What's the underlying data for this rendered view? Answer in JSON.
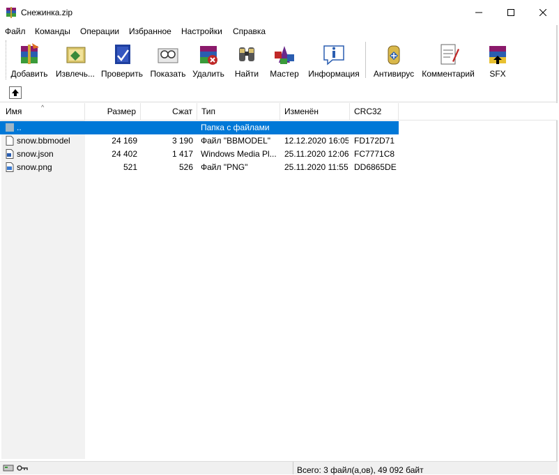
{
  "window": {
    "title": "Снежинка.zip"
  },
  "menu": [
    "Файл",
    "Команды",
    "Операции",
    "Избранное",
    "Настройки",
    "Справка"
  ],
  "toolbar": [
    {
      "label": "Добавить",
      "icon": "add-archive-icon"
    },
    {
      "label": "Извлечь...",
      "icon": "extract-icon"
    },
    {
      "label": "Проверить",
      "icon": "test-icon"
    },
    {
      "label": "Показать",
      "icon": "view-icon"
    },
    {
      "label": "Удалить",
      "icon": "delete-icon"
    },
    {
      "label": "Найти",
      "icon": "find-icon"
    },
    {
      "label": "Мастер",
      "icon": "wizard-icon"
    },
    {
      "label": "Информация",
      "icon": "info-icon"
    },
    {
      "label": "Антивирус",
      "icon": "antivirus-icon"
    },
    {
      "label": "Комментарий",
      "icon": "comment-icon"
    },
    {
      "label": "SFX",
      "icon": "sfx-icon"
    }
  ],
  "columns": [
    "Имя",
    "Размер",
    "Сжат",
    "Тип",
    "Изменён",
    "CRC32"
  ],
  "rows": [
    {
      "name": "..",
      "size": "",
      "packed": "",
      "type": "Папка с файлами",
      "modified": "",
      "crc": "",
      "selected": true
    },
    {
      "name": "snow.bbmodel",
      "size": "24 169",
      "packed": "3 190",
      "type": "Файл \"BBMODEL\"",
      "modified": "12.12.2020 16:05",
      "crc": "FD172D71"
    },
    {
      "name": "snow.json",
      "size": "24 402",
      "packed": "1 417",
      "type": "Windows Media Pl...",
      "modified": "25.11.2020 12:06",
      "crc": "FC7771C8"
    },
    {
      "name": "snow.png",
      "size": "521",
      "packed": "526",
      "type": "Файл \"PNG\"",
      "modified": "25.11.2020 11:55",
      "crc": "DD6865DE"
    }
  ],
  "status": {
    "summary": "Всего: 3 файл(а,ов), 49 092 байт"
  },
  "colors": {
    "selection": "#0078d7"
  }
}
